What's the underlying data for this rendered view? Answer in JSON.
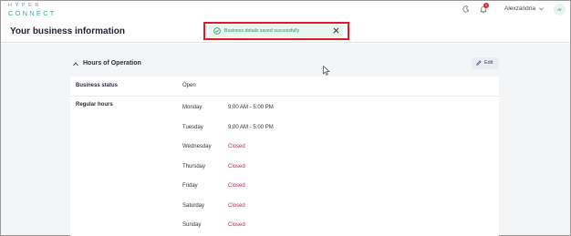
{
  "app": {
    "logo_top": "HYPER",
    "logo_bottom": "CONNECT",
    "user_name": "Alexzandria",
    "user_initials": "Ar",
    "notification_count": "1"
  },
  "page": {
    "title": "Your business information"
  },
  "toast": {
    "message": "Business details saved successfully"
  },
  "section": {
    "title": "Hours of Operation",
    "edit_label": "Edit"
  },
  "business_status": {
    "label": "Business status",
    "value": "Open"
  },
  "regular_hours": {
    "label": "Regular hours",
    "days": [
      {
        "day": "Monday",
        "hours": "9:00 AM  - 5:00 PM"
      },
      {
        "day": "Tuesday",
        "hours": "9:00 AM  - 5:00 PM"
      },
      {
        "day": "Wednesday",
        "hours": "Closed"
      },
      {
        "day": "Thursday",
        "hours": "Closed"
      },
      {
        "day": "Friday",
        "hours": "Closed"
      },
      {
        "day": "Saturday",
        "hours": "Closed"
      },
      {
        "day": "Sunday",
        "hours": "Closed"
      }
    ]
  },
  "colors": {
    "accent": "#3da89a",
    "success": "#2f8f5b",
    "closed": "#b0304a",
    "highlight": "#e01a2a"
  },
  "icons": [
    "moon-icon",
    "bell-icon",
    "chevron-down-icon",
    "check-circle-icon",
    "close-icon",
    "chevron-up-icon",
    "pencil-icon"
  ]
}
